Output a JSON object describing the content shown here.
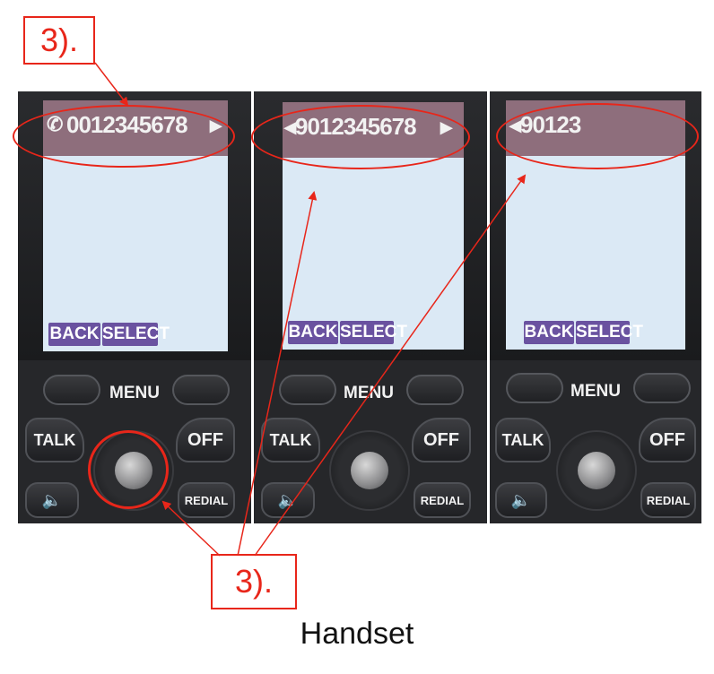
{
  "callouts": {
    "top": "3).",
    "bottom": "3)."
  },
  "phones": [
    {
      "display": "0012345678",
      "left_arrow": "",
      "right_arrow": "▸",
      "softkeys": {
        "back": "BACK",
        "select": "SELECT"
      },
      "keys": {
        "menu": "MENU",
        "talk": "TALK",
        "off": "OFF",
        "redial": "REDIAL"
      }
    },
    {
      "display": "9012345678",
      "left_arrow": "◂",
      "right_arrow": "▸",
      "softkeys": {
        "back": "BACK",
        "select": "SELECT"
      },
      "keys": {
        "menu": "MENU",
        "talk": "TALK",
        "off": "OFF",
        "redial": "REDIAL"
      }
    },
    {
      "display": "90123",
      "left_arrow": "◂",
      "right_arrow": "",
      "softkeys": {
        "back": "BACK",
        "select": "SELECT"
      },
      "keys": {
        "menu": "MENU",
        "talk": "TALK",
        "off": "OFF",
        "redial": "REDIAL"
      }
    }
  ],
  "caption": "Handset",
  "colors": {
    "annotation": "#e8261a",
    "display_bar": "#8e6e7c",
    "softkey": "#6a52a0",
    "screen": "#dbe9f5"
  }
}
